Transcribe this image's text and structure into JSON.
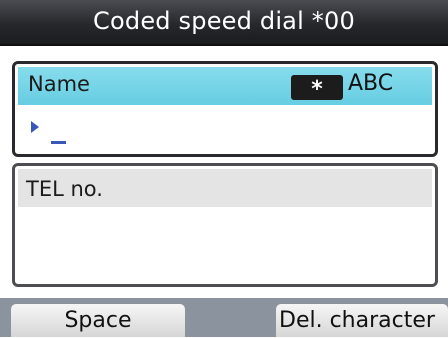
{
  "title": "Coded speed dial *00",
  "name_field": {
    "label": "Name",
    "mode_key": "*",
    "mode_label": "ABC",
    "value": ""
  },
  "tel_field": {
    "label": "TEL no."
  },
  "soft_keys": {
    "left": "Space",
    "right": "Del. character"
  },
  "icons": {
    "cursor": "triangle-right-icon",
    "mode_key": "star-key-icon"
  },
  "colors": {
    "title_bar": "#26282c",
    "name_highlight": "#67cde2",
    "tel_header": "#e4e4e4",
    "bottom_bar": "#8b949e",
    "cursor": "#3a56b8"
  }
}
